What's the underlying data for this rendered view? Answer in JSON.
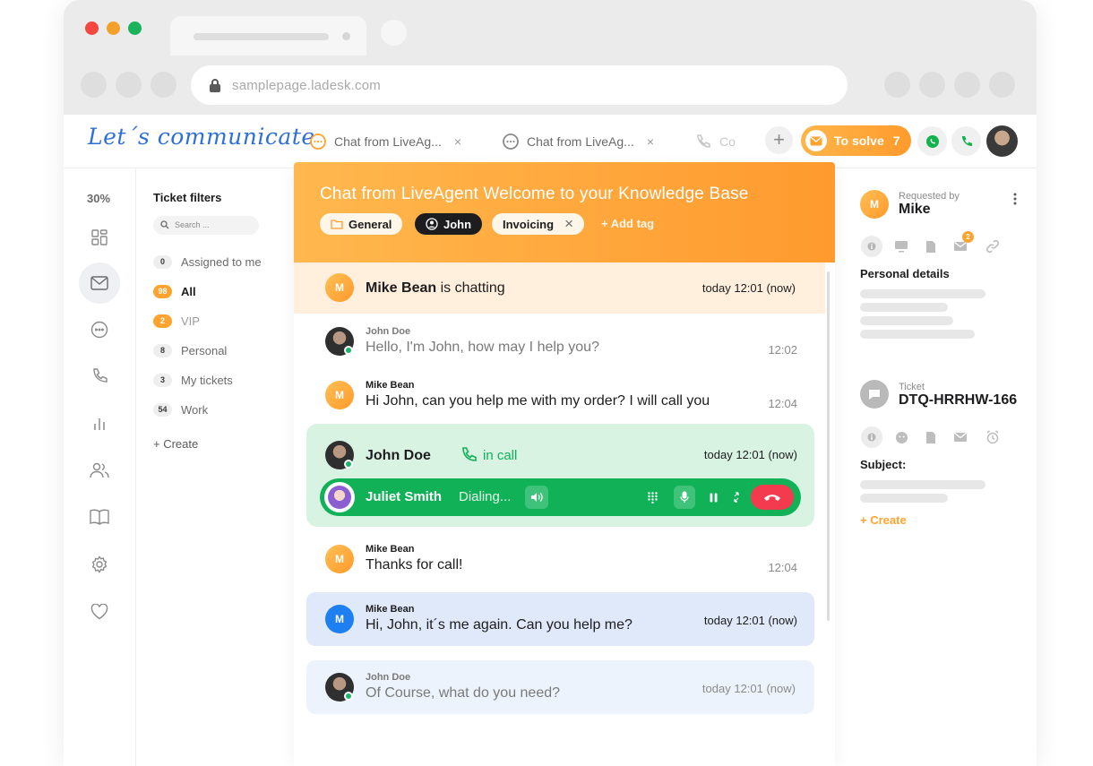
{
  "browser": {
    "url": "samplepage.ladesk.com"
  },
  "logo": "Let´s communicate",
  "tabs": [
    {
      "label": "Chat from LiveAg...",
      "close": "×"
    },
    {
      "label": "Chat from LiveAg...",
      "close": "×"
    },
    {
      "label": "Co"
    }
  ],
  "toolbar": {
    "plus": "+",
    "to_solve_label": "To solve",
    "to_solve_count": "7"
  },
  "rail": {
    "percent": "30%"
  },
  "filters": {
    "title": "Ticket filters",
    "search_placeholder": "Search ...",
    "items": [
      {
        "count": "0",
        "label": "Assigned to me"
      },
      {
        "count": "98",
        "label": "All"
      },
      {
        "count": "2",
        "label": "VIP"
      },
      {
        "count": "8",
        "label": "Personal"
      },
      {
        "count": "3",
        "label": "My tickets"
      },
      {
        "count": "54",
        "label": "Work"
      }
    ],
    "create": "+ Create"
  },
  "ticket": {
    "title": "Chat from LiveAgent Welcome to your Knowledge Base",
    "tags": [
      {
        "label": "General"
      },
      {
        "label": "John"
      },
      {
        "label": "Invoicing",
        "close": "×"
      }
    ],
    "add_tag": "+ Add tag"
  },
  "chat": {
    "status": {
      "avatar": "M",
      "name": "Mike Bean",
      "text": "is chatting",
      "time": "today 12:01 (now)"
    },
    "messages": [
      {
        "name": "John Doe",
        "text": "Hello, I'm John, how may I help you?",
        "time": "12:02"
      },
      {
        "name": "Mike Bean",
        "avatar": "M",
        "text": "Hi John, can you help me with my order? I will call you",
        "time": "12:04"
      },
      {
        "name": "Mike Bean",
        "avatar": "M",
        "text": "Thanks for call!",
        "time": "12:04"
      },
      {
        "name": "Mike Bean",
        "avatar": "M",
        "text": "Hi, John, it´s me again. Can you help me?",
        "time": "today 12:01 (now)"
      },
      {
        "name": "John Doe",
        "text": "Of Course, what do you need?",
        "time": "today 12:01 (now)"
      }
    ],
    "call": {
      "caller": "John Doe",
      "status": "in call",
      "time": "today 12:01 (now)",
      "callee": "Juliet Smith",
      "dialing": "Dialing..."
    }
  },
  "details": {
    "requested_by_label": "Requested by",
    "requester": "Mike",
    "requester_avatar": "M",
    "mail_badge": "2",
    "personal_details": "Personal details",
    "ticket_label": "Ticket",
    "ticket_id": "DTQ-HRRHW-166",
    "subject": "Subject:",
    "create": "+ Create"
  },
  "colors": {
    "accent_orange": "#ff9b2c",
    "call_green": "#10b157",
    "hangup_red": "#f43a4e",
    "logo_blue": "#2f6fd8"
  }
}
